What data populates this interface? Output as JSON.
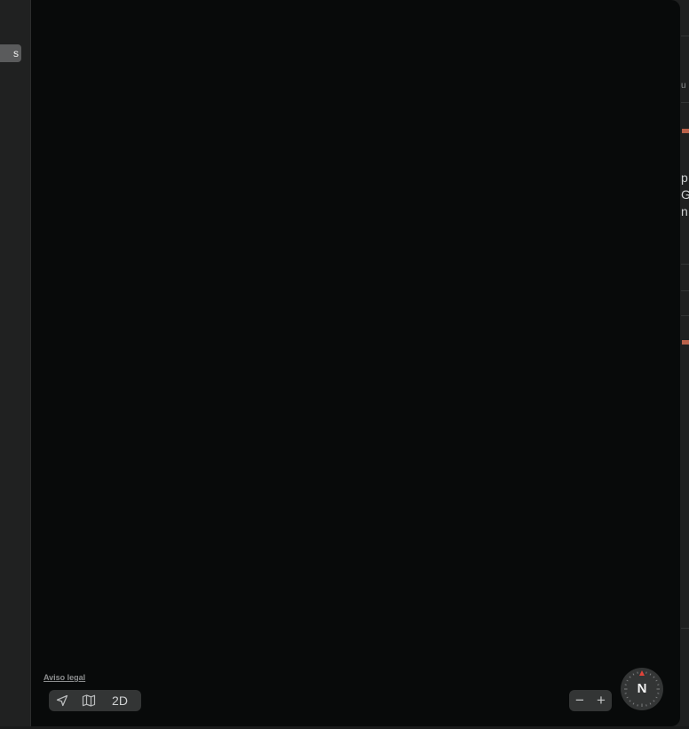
{
  "sidebar": {
    "chip_label": "s"
  },
  "map": {
    "legal_link": "Aviso legal",
    "toolbar": {
      "location_icon": "location-arrow-icon",
      "map_icon": "map-icon",
      "view_mode_label": "2D"
    },
    "zoom": {
      "zoom_out_label": "−",
      "zoom_in_label": "+"
    },
    "compass": {
      "label": "N"
    }
  },
  "right_panel": {
    "header_fragment": "u",
    "text_line_1": "p",
    "text_line_2": "G",
    "text_line_3": "n"
  },
  "colors": {
    "map_background": "#080a0a",
    "panel_background": "#1f2020",
    "control_background": "#333535",
    "accent": "#b9614a",
    "compass_north": "#e0443a"
  }
}
